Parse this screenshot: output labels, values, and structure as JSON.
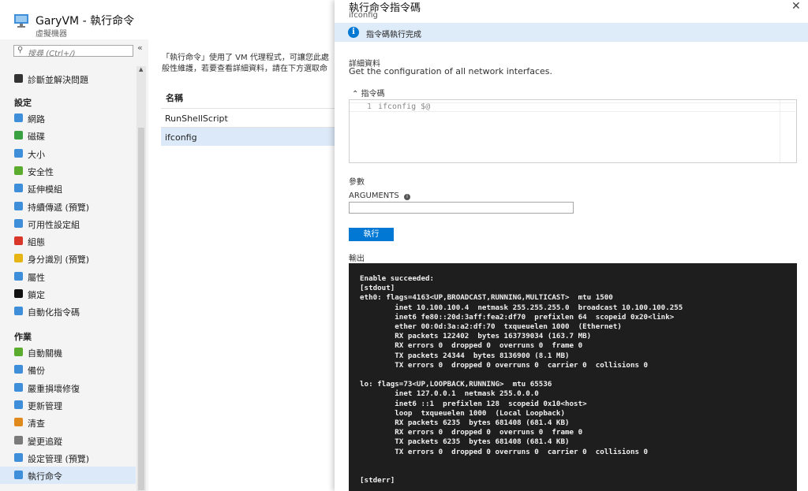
{
  "vm": {
    "title": "GaryVM - 執行命令",
    "subtitle": "虛擬機器"
  },
  "search": {
    "placeholder": "搜尋 (Ctrl+/)"
  },
  "sidebar": {
    "top_items": [
      {
        "label": "診斷並解決問題",
        "icon": "wrench-icon"
      }
    ],
    "settings_header": "設定",
    "settings_items": [
      {
        "label": "網路",
        "icon": "network-icon",
        "color": "#3e8eda"
      },
      {
        "label": "磁碟",
        "icon": "disk-icon",
        "color": "#3aa142"
      },
      {
        "label": "大小",
        "icon": "monitor-icon",
        "color": "#3e8eda"
      },
      {
        "label": "安全性",
        "icon": "shield-icon",
        "color": "#5aab2e"
      },
      {
        "label": "延伸模組",
        "icon": "extension-icon",
        "color": "#3e8eda"
      },
      {
        "label": "持續傳遞 (預覽)",
        "icon": "delivery-icon",
        "color": "#3e8eda"
      },
      {
        "label": "可用性設定組",
        "icon": "availability-icon",
        "color": "#3e8eda"
      },
      {
        "label": "組態",
        "icon": "config-icon",
        "color": "#d9372a"
      },
      {
        "label": "身分識別 (預覽)",
        "icon": "identity-key-icon",
        "color": "#e7b416"
      },
      {
        "label": "屬性",
        "icon": "properties-icon",
        "color": "#3e8eda"
      },
      {
        "label": "鎖定",
        "icon": "lock-icon",
        "color": "#111111"
      },
      {
        "label": "自動化指令碼",
        "icon": "automation-icon",
        "color": "#3e8eda"
      }
    ],
    "ops_header": "作業",
    "ops_items": [
      {
        "label": "自動關機",
        "icon": "clock-icon",
        "color": "#5aab2e"
      },
      {
        "label": "備份",
        "icon": "backup-cloud-icon",
        "color": "#3e8eda"
      },
      {
        "label": "嚴重損壞修復",
        "icon": "recovery-cloud-icon",
        "color": "#3e8eda"
      },
      {
        "label": "更新管理",
        "icon": "update-icon",
        "color": "#3e8eda"
      },
      {
        "label": "清查",
        "icon": "inventory-icon",
        "color": "#e08a1e"
      },
      {
        "label": "變更追蹤",
        "icon": "change-tracking-icon",
        "color": "#7a7a7a"
      },
      {
        "label": "設定管理 (預覽)",
        "icon": "config-management-icon",
        "color": "#3e8eda"
      },
      {
        "label": "執行命令",
        "icon": "run-command-icon",
        "color": "#3e8eda"
      }
    ]
  },
  "middle": {
    "desc_line1": "「執行命令」使用了 VM 代理程式，可讓您此處",
    "desc_line2": "般性維護，若要查看詳細資料，請在下方選取命",
    "col_name": "名稱",
    "rows": [
      "RunShellScript",
      "ifconfig"
    ]
  },
  "panel": {
    "title": "執行命令指令碼",
    "subtitle": "ifconfig",
    "info": "指令碼執行完成",
    "details_label": "詳細資料",
    "details_text": "Get the configuration of all network interfaces.",
    "script_label": "指令碼",
    "line_number": "1",
    "script_code": "ifconfig $@",
    "params_label": "參數",
    "arguments_label": "ARGUMENTS",
    "arguments_value": "",
    "run_label": "執行",
    "output_label": "輸出",
    "output": "Enable succeeded:\n[stdout]\neth0: flags=4163<UP,BROADCAST,RUNNING,MULTICAST>  mtu 1500\n        inet 10.100.100.4  netmask 255.255.255.0  broadcast 10.100.100.255\n        inet6 fe80::20d:3aff:fea2:df70  prefixlen 64  scopeid 0x20<link>\n        ether 00:0d:3a:a2:df:70  txqueuelen 1000  (Ethernet)\n        RX packets 122402  bytes 163739034 (163.7 MB)\n        RX errors 0  dropped 0  overruns 0  frame 0\n        TX packets 24344  bytes 8136900 (8.1 MB)\n        TX errors 0  dropped 0 overruns 0  carrier 0  collisions 0\n\nlo: flags=73<UP,LOOPBACK,RUNNING>  mtu 65536\n        inet 127.0.0.1  netmask 255.0.0.0\n        inet6 ::1  prefixlen 128  scopeid 0x10<host>\n        loop  txqueuelen 1000  (Local Loopback)\n        RX packets 6235  bytes 681408 (681.4 KB)\n        RX errors 0  dropped 0  overruns 0  frame 0\n        TX packets 6235  bytes 681408 (681.4 KB)\n        TX errors 0  dropped 0 overruns 0  carrier 0  collisions 0\n\n\n[stderr]"
  }
}
